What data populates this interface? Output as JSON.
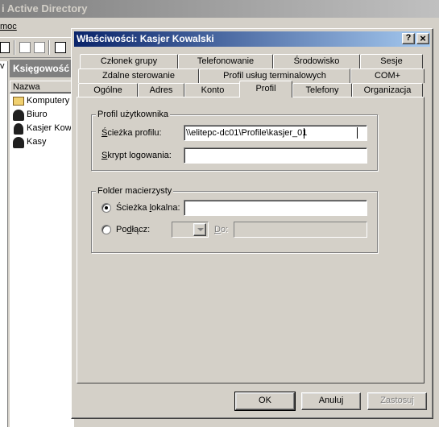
{
  "background_app": {
    "title_fragment": "i Active Directory",
    "menu_fragment": "moc",
    "panel_title": "Księgowość",
    "column_header": "Nazwa",
    "items": [
      {
        "label": "Komputery",
        "icon": "folder-icon"
      },
      {
        "label": "Biuro",
        "icon": "group-icon"
      },
      {
        "label": "Kasjer Kowa",
        "icon": "user-icon"
      },
      {
        "label": "Kasy",
        "icon": "group-icon"
      }
    ]
  },
  "dialog": {
    "title": "Właściwości: Kasjer Kowalski",
    "help_label": "?",
    "close_label": "×",
    "tabs_row1": [
      "Członek grupy",
      "Telefonowanie",
      "Środowisko",
      "Sesje"
    ],
    "tabs_row2": [
      "Zdalne sterowanie",
      "Profil usług terminalowych",
      "COM+"
    ],
    "tabs_row3": [
      "Ogólne",
      "Adres",
      "Konto",
      "Profil",
      "Telefony",
      "Organizacja"
    ],
    "active_tab": "Profil",
    "user_profile": {
      "group_label": "Profil użytkownika",
      "profile_path_label_pre": "Ś",
      "profile_path_label_post": "cieżka profilu:",
      "profile_path_value": "\\\\elitepc-dc01\\Profile\\kasjer_01",
      "logon_script_label_pre": "S",
      "logon_script_label_post": "krypt logowania:",
      "logon_script_value": ""
    },
    "home_folder": {
      "group_label": "Folder macierzysty",
      "local_path_label_pre": "Ścieżka ",
      "local_path_label_u": "l",
      "local_path_label_post": "okalna:",
      "local_path_value": "",
      "local_path_selected": true,
      "connect_label_pre": "Po",
      "connect_label_u": "d",
      "connect_label_post": "łącz:",
      "to_label_u": "D",
      "to_label_post": "o:"
    },
    "buttons": {
      "ok": "OK",
      "cancel": "Anuluj",
      "apply": "Zastosuj"
    }
  },
  "colors": {
    "title_bar_start": "#0a246a",
    "title_bar_end": "#a6caf0",
    "inactive_title": "#808080",
    "face": "#d4d0c8"
  }
}
